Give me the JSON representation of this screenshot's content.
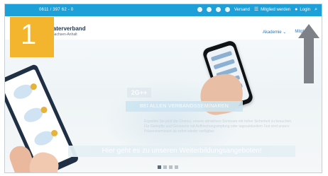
{
  "topbar": {
    "phone": "0611 / 397 62 - 0",
    "versand": "Versand",
    "mitglied": "Mitglied werden",
    "login": "Login"
  },
  "header": {
    "logo_line1": "...raterverband",
    "logo_line2": "...n Sachsen-Anhalt",
    "nav": [
      "Akademie ⌄",
      "Mitgl..."
    ]
  },
  "hero": {
    "badge_2g": "2G++",
    "seminars": "BEI ALLEN VERBANDSSEMINAREN",
    "paragraph": "Ergreifen Sie jetzt die Chance, unsere attraktiven Seminare mit hoher Sicherheit zu besuchen. Für Geimpfte und Genesene mit Auffrischungsimpfung oder tagesaktuellem Test sind unsere Präsenzseminare ab sofort wieder verfügbar.",
    "cta": "Hier geht es zu unseren Weiterbildungsangeboten!"
  },
  "step_number": "1",
  "colors": {
    "topbar": "#1d9fd8",
    "badge": "#f3b52d",
    "arrow": "#7e8288"
  }
}
